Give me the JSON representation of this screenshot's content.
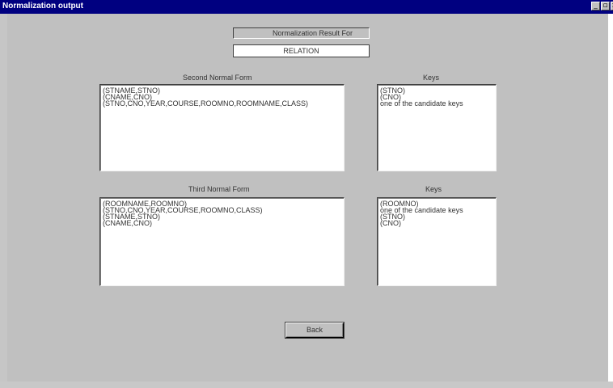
{
  "window": {
    "title": "Normalization output"
  },
  "header": {
    "label": "Normalization Result For",
    "relation": "RELATION"
  },
  "second_nf": {
    "label": "Second Normal Form",
    "rows": [
      "(STNAME,STNO)",
      "(CNAME,CNO)",
      "(STNO,CNO,YEAR,COURSE,ROOMNO,ROOMNAME,CLASS)"
    ]
  },
  "second_keys": {
    "label": "Keys",
    "rows": [
      "(STNO)",
      "(CNO)",
      "one of the candidate keys"
    ]
  },
  "third_nf": {
    "label": "Third Normal Form",
    "rows": [
      "(ROOMNAME,ROOMNO)",
      "(STNO,CNO,YEAR,COURSE,ROOMNO,CLASS)",
      "(STNAME,STNO)",
      "(CNAME,CNO)"
    ]
  },
  "third_keys": {
    "label": "Keys",
    "rows": [
      "(ROOMNO)",
      "one of the candidate keys",
      "(STNO)",
      "(CNO)"
    ]
  },
  "buttons": {
    "back": "Back"
  },
  "icons": [
    "minimize-icon",
    "maximize-icon",
    "close-icon"
  ]
}
